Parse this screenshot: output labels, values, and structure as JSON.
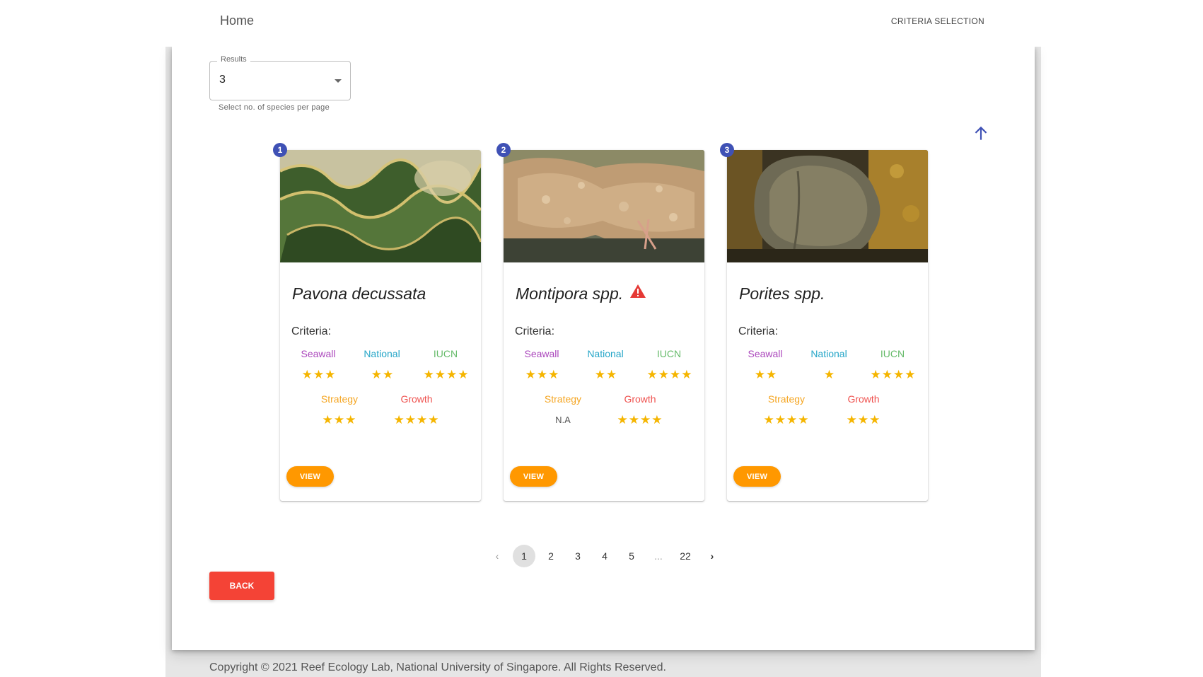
{
  "header": {
    "home_label": "Home",
    "criteria_label": "CRITERIA SELECTION"
  },
  "results": {
    "label": "Results",
    "value": "3",
    "helper": "Select no. of species per page"
  },
  "colors": {
    "seawall": "#ab47bc",
    "national": "#26a6c8",
    "iucn": "#66bb6a",
    "strategy": "#f5a623",
    "growth": "#ef5350",
    "star": "#f5b500",
    "badge": "#3f51b5",
    "view_button": "#ff9800",
    "back_button": "#f44336",
    "warning": "#e53935"
  },
  "criteria_labels": {
    "heading": "Criteria:",
    "seawall": "Seawall",
    "national": "National",
    "iucn": "IUCN",
    "strategy": "Strategy",
    "growth": "Growth"
  },
  "cards": [
    {
      "index": "1",
      "name": "Pavona decussata",
      "warning": false,
      "ratings": {
        "seawall": 3,
        "national": 2,
        "iucn": 4,
        "strategy": 3,
        "growth": 4
      },
      "strategy_text": "",
      "view_label": "VIEW"
    },
    {
      "index": "2",
      "name": "Montipora spp.",
      "warning": true,
      "ratings": {
        "seawall": 3,
        "national": 2,
        "iucn": 4,
        "strategy": null,
        "growth": 4
      },
      "strategy_text": "N.A",
      "view_label": "VIEW"
    },
    {
      "index": "3",
      "name": "Porites spp.",
      "warning": false,
      "ratings": {
        "seawall": 2,
        "national": 1,
        "iucn": 4,
        "strategy": 4,
        "growth": 3
      },
      "strategy_text": "",
      "view_label": "VIEW"
    }
  ],
  "pagination": {
    "pages": [
      "1",
      "2",
      "3",
      "4",
      "5",
      "...",
      "22"
    ],
    "current": "1"
  },
  "back_label": "BACK",
  "footer": "Copyright © 2021 Reef Ecology Lab, National University of Singapore. All Rights Reserved."
}
